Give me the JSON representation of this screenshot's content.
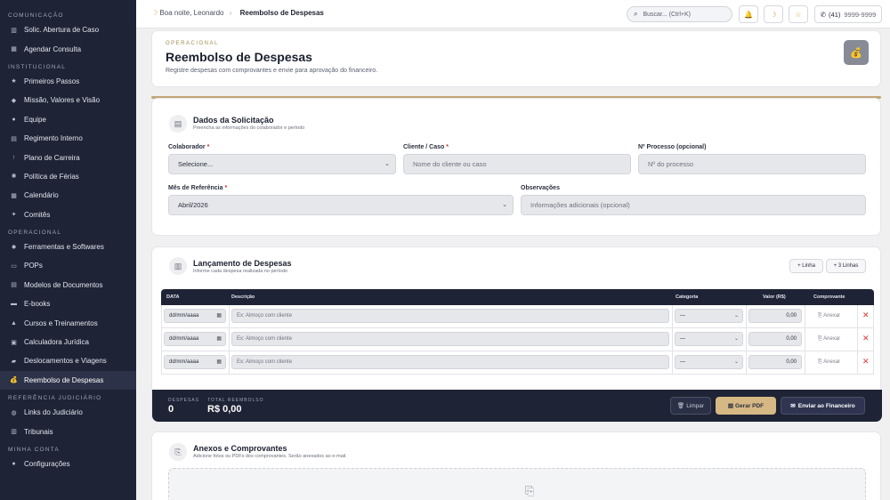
{
  "sidebar": {
    "sections": [
      {
        "title": "Comunicação",
        "items": [
          {
            "label": "Solic. Abertura de Caso",
            "icon": "building-icon"
          },
          {
            "label": "Agendar Consulta",
            "icon": "calendar-icon"
          }
        ]
      },
      {
        "title": "Institucional",
        "items": [
          {
            "label": "Primeiros Passos",
            "icon": "star-icon"
          },
          {
            "label": "Missão, Valores e Visão",
            "icon": "diamond-icon"
          },
          {
            "label": "Equipe",
            "icon": "team-icon"
          },
          {
            "label": "Regimento Interno",
            "icon": "book-icon"
          },
          {
            "label": "Plano de Carreira",
            "icon": "arrow-up-icon"
          },
          {
            "label": "Política de Férias",
            "icon": "sun-icon"
          },
          {
            "label": "Calendário",
            "icon": "calendar-icon"
          },
          {
            "label": "Comitês",
            "icon": "group-icon"
          }
        ]
      },
      {
        "title": "Operacional",
        "items": [
          {
            "label": "Ferramentas e Softwares",
            "icon": "gear-icon"
          },
          {
            "label": "POPs",
            "icon": "clipboard-icon"
          },
          {
            "label": "Modelos de Documentos",
            "icon": "document-icon"
          },
          {
            "label": "E-books",
            "icon": "ebook-icon"
          },
          {
            "label": "Cursos e Treinamentos",
            "icon": "graduation-icon"
          },
          {
            "label": "Calculadora Jurídica",
            "icon": "calculator-icon"
          },
          {
            "label": "Deslocamentos e Viagens",
            "icon": "car-icon"
          },
          {
            "label": "Reembolso de Despesas",
            "icon": "money-bag-icon",
            "active": true
          }
        ]
      },
      {
        "title": "Referência Judiciário",
        "items": [
          {
            "label": "Links do Judiciário",
            "icon": "globe-icon"
          },
          {
            "label": "Tribunais",
            "icon": "court-icon"
          }
        ]
      },
      {
        "title": "Minha Conta",
        "items": [
          {
            "label": "Configurações",
            "icon": "user-icon"
          }
        ]
      }
    ]
  },
  "topbar": {
    "greeting": "Boa noite, Leonardo",
    "breadcrumb_sep": "›",
    "page": "Reembolso de Despesas",
    "search_label": "Buscar... (Ctrl+K)",
    "phone_prefix": "(41)",
    "phone_number": "9999-9999"
  },
  "header": {
    "overline": "OPERACIONAL",
    "title": "Reembolso de Despesas",
    "subtitle": "Registre despesas com comprovantes e envie para aprovação do financeiro."
  },
  "dados": {
    "title": "Dados da Solicitação",
    "subtitle": "Preencha as informações do colaborador e período",
    "colaborador_label": "Colaborador",
    "colaborador_value": "Selecione...",
    "cliente_label": "Cliente / Caso",
    "cliente_placeholder": "Nome do cliente ou caso",
    "processo_label": "Nº Processo (opcional)",
    "processo_placeholder": "Nº do processo",
    "mes_label": "Mês de Referência",
    "mes_value": "Abril/2026",
    "obs_label": "Observações",
    "obs_placeholder": "Informações adicionais (opcional)",
    "required_mark": "*"
  },
  "lancamento": {
    "title": "Lançamento de Despesas",
    "subtitle": "Informe cada despesa realizada no período",
    "add_line": "+ Linha",
    "add_3_lines": "+ 3 Linhas",
    "columns": {
      "data": "DATA",
      "descricao": "Descrição",
      "categoria": "Categoria",
      "valor": "Valor (R$)",
      "comprovante": "Comprovante"
    },
    "rows": [
      {
        "date": "dd/mm/aaaa",
        "desc_placeholder": "Ex: Almoço com cliente",
        "categoria": "—",
        "valor": "0,00",
        "attach": "Anexar"
      },
      {
        "date": "dd/mm/aaaa",
        "desc_placeholder": "Ex: Almoço com cliente",
        "categoria": "—",
        "valor": "0,00",
        "attach": "Anexar"
      },
      {
        "date": "dd/mm/aaaa",
        "desc_placeholder": "Ex: Almoço com cliente",
        "categoria": "—",
        "valor": "0,00",
        "attach": "Anexar"
      }
    ],
    "footer": {
      "despesas_label": "DESPESAS",
      "despesas_value": "0",
      "total_label": "TOTAL REEMBOLSO",
      "total_value": "R$ 0,00",
      "limpar": "Limpar",
      "gerar_pdf": "Gerar PDF",
      "enviar": "Enviar ao Financeiro"
    }
  },
  "anexos": {
    "title": "Anexos e Comprovantes",
    "subtitle": "Adicione fotos ou PDFs dos comprovantes. Serão anexados ao e-mail."
  },
  "colors": {
    "sidebar_bg": "#1e2335",
    "accent_gold": "#d8b35a",
    "gold_button": "#d6b884",
    "danger": "#dd3333"
  }
}
